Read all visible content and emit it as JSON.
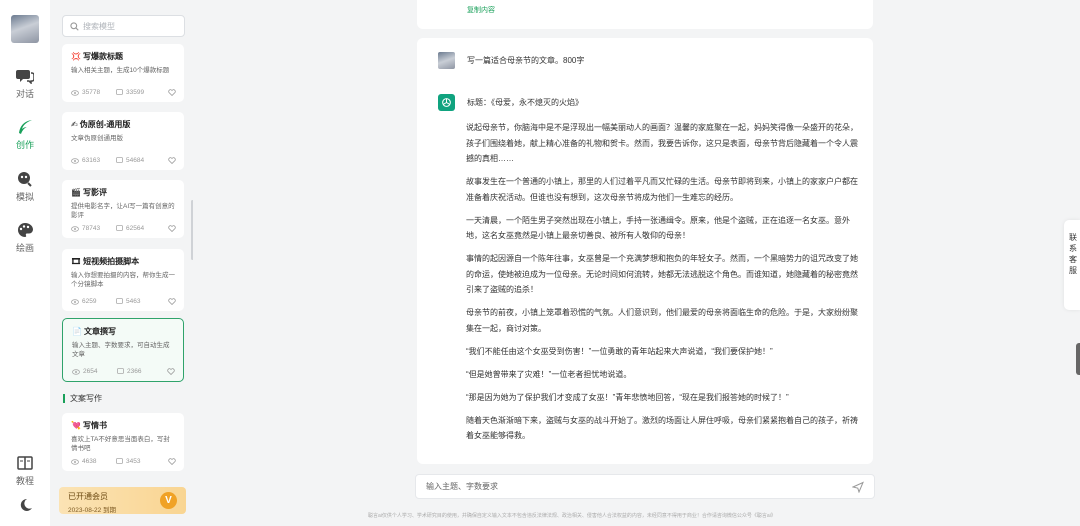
{
  "nav": [
    {
      "label": "对话",
      "icon": "chat-icon"
    },
    {
      "label": "创作",
      "icon": "feather-icon"
    },
    {
      "label": "模拟",
      "icon": "role-play-icon"
    },
    {
      "label": "绘画",
      "icon": "palette-icon"
    }
  ],
  "bottom_nav": {
    "tutorial": "教程",
    "theme_icon": "moon-icon"
  },
  "search": {
    "placeholder": "搜索模型"
  },
  "models": [
    {
      "emoji": "💢",
      "title": "写爆款标题",
      "desc": "输入相关主题，生成10个爆款标题",
      "views": "35778",
      "uses": "33599"
    },
    {
      "emoji": "✍",
      "title": "伪原创-通用版",
      "desc": "文章伪原创通用版",
      "views": "63163",
      "uses": "54684"
    },
    {
      "emoji": "🎬",
      "title": "写影评",
      "desc": "提供电影名字，让AI写一篇有创意的影评",
      "views": "78743",
      "uses": "62564"
    },
    {
      "emoji": "🎞",
      "title": "短视频拍摄脚本",
      "desc": "输入你想要拍摄的内容，帮你生成一个分镜脚本",
      "views": "6259",
      "uses": "5463"
    },
    {
      "emoji": "📄",
      "title": "文章撰写",
      "desc": "输入主题、字数要求，可自动生成文章",
      "views": "2654",
      "uses": "2366",
      "selected": true
    }
  ],
  "section": {
    "title": "文案写作"
  },
  "section_models": [
    {
      "emoji": "💘",
      "title": "写情书",
      "desc": "喜欢上TA不好意思当面表白，写封情书吧",
      "views": "4638",
      "uses": "3453"
    }
  ],
  "vip": {
    "title": "已开通会员",
    "expiry": "2023-08-22 到期",
    "badge": "V"
  },
  "previous": {
    "copy_label": "复制内容"
  },
  "chat": {
    "user_message": "写一篇适合母亲节的文章。800字",
    "ai_title": "标题：《母爱，永不熄灭的火焰》",
    "paragraphs": [
      "说起母亲节，你脑海中是不是浮现出一幅美丽动人的画面？温馨的家庭聚在一起，妈妈笑得像一朵盛开的花朵，孩子们围绕着她，献上精心准备的礼物和贺卡。然而，我要告诉你，这只是表面，母亲节背后隐藏着一个令人震撼的真相……",
      "故事发生在一个普通的小镇上，那里的人们过着平凡而又忙碌的生活。母亲节即将到来，小镇上的家家户户都在准备着庆祝活动。但谁也没有想到，这次母亲节将成为他们一生难忘的经历。",
      "一天清晨，一个陌生男子突然出现在小镇上，手持一张通缉令。原来，他是个盗贼，正在追逐一名女巫。意外地，这名女巫竟然是小镇上最亲切善良、被所有人敬仰的母亲！",
      "事情的起因源自一个陈年往事，女巫曾是一个充满梦想和抱负的年轻女子。然而，一个黑暗势力的诅咒改变了她的命运，使她被迫成为一位母亲。无论时间如何流转，她都无法逃脱这个角色。而谁知道，她隐藏着的秘密竟然引来了盗贼的追杀！",
      "母亲节的前夜，小镇上笼罩着恐慌的气氛。人们意识到，他们最爱的母亲将面临生命的危险。于是，大家纷纷聚集在一起，商讨对策。",
      "“我们不能任由这个女巫受到伤害！”一位勇敢的青年站起来大声说道，“我们要保护她！”",
      "“但是她曾带来了灾难！”一位老者担忧地说道。",
      "“那是因为她为了保护我们才变成了女巫！”青年悲愤地回答，“现在是我们报答她的时候了！”",
      "随着天色渐渐暗下来，盗贼与女巫的战斗开始了。激烈的场面让人屏住呼吸，母亲们紧紧抱着自己的孩子，祈祷着女巫能够得救。"
    ]
  },
  "composer": {
    "placeholder": "输入主题、字数要求"
  },
  "footer": {
    "text": "聪言ai仅供个人学习、学术研究目的使用，并确保自定义输入文本不包含违反法律法规、政治相关、侵害他人合法权益的内容，未经同意不得用于商业！合作请咨询微信公众号《聪言ai》"
  },
  "float": {
    "contact": "联系客服"
  },
  "colors": {
    "accent": "#19a05a",
    "panel_bg": "#f3f4f5",
    "vip_badge": "#f0a226",
    "ai_avatar": "#10a37f"
  }
}
